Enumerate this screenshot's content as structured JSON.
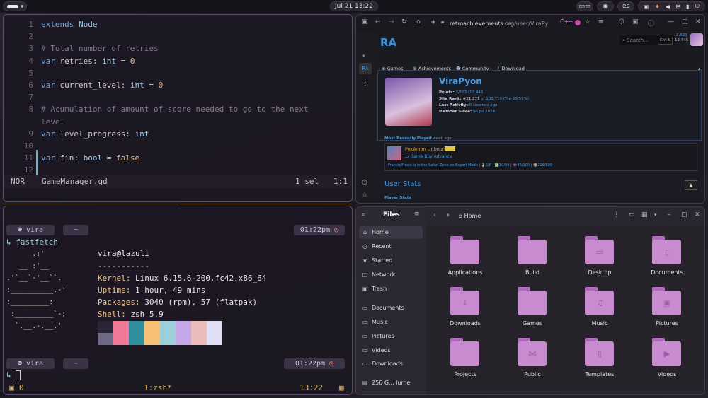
{
  "topbar": {
    "clock": "Jul 21  13:22",
    "keyboard_layout": "es",
    "tray_icons": [
      "gamepad-icon",
      "discord-icon",
      "volume-icon",
      "network-icon",
      "battery-icon",
      "power-icon"
    ]
  },
  "editor": {
    "lines": [
      {
        "num": "1",
        "parts": [
          {
            "t": "extends ",
            "c": "kw"
          },
          {
            "t": "Node",
            "c": "ty"
          }
        ]
      },
      {
        "num": "2",
        "parts": []
      },
      {
        "num": "3",
        "parts": [
          {
            "t": "# Total number of retries",
            "c": "comment"
          }
        ]
      },
      {
        "num": "4",
        "parts": [
          {
            "t": "var ",
            "c": "kw"
          },
          {
            "t": "retries: ",
            "c": ""
          },
          {
            "t": "int",
            "c": "ty"
          },
          {
            "t": " = ",
            "c": ""
          },
          {
            "t": "0",
            "c": "val"
          }
        ]
      },
      {
        "num": "5",
        "parts": []
      },
      {
        "num": "6",
        "parts": [
          {
            "t": "var ",
            "c": "kw"
          },
          {
            "t": "current_level: ",
            "c": ""
          },
          {
            "t": "int",
            "c": "ty"
          },
          {
            "t": " = ",
            "c": ""
          },
          {
            "t": "0",
            "c": "val"
          }
        ]
      },
      {
        "num": "7",
        "parts": []
      },
      {
        "num": "8",
        "parts": [
          {
            "t": "# Acumulation of amount of score needed to go to the next",
            "c": "comment"
          }
        ]
      },
      {
        "num": "",
        "parts": [
          {
            "t": "level",
            "c": "comment"
          }
        ]
      },
      {
        "num": "9",
        "parts": [
          {
            "t": "var ",
            "c": "kw"
          },
          {
            "t": "level_progress: ",
            "c": ""
          },
          {
            "t": "int",
            "c": "ty"
          }
        ]
      },
      {
        "num": "10",
        "parts": []
      },
      {
        "num": "11",
        "parts": [
          {
            "t": "var ",
            "c": "kw"
          },
          {
            "t": "fin: ",
            "c": ""
          },
          {
            "t": "bool",
            "c": "ty"
          },
          {
            "t": " = ",
            "c": ""
          },
          {
            "t": "false",
            "c": "val"
          }
        ]
      },
      {
        "num": "12",
        "parts": []
      }
    ],
    "status": {
      "mode": "NOR",
      "file": "GameManager.gd",
      "selection": "1 sel",
      "position": "1:1"
    }
  },
  "terminal": {
    "prompt_user": "vira",
    "prompt_dir": "~",
    "prompt_time": "01:22pm",
    "command": "fastfetch",
    "ascii": [
      "      .:'",
      "   __ :'__",
      ".'`__`-'__``.",
      ":__________.-'",
      ":_________:",
      " :_________`-;",
      "  `.__.-.__.'"
    ],
    "userhost": "vira@lazuli",
    "separator": "-----------",
    "info": [
      {
        "key": "Kernel",
        "value": "Linux 6.15.6-200.fc42.x86_64"
      },
      {
        "key": "Uptime",
        "value": "1 hour, 49 mins"
      },
      {
        "key": "Packages",
        "value": "3040 (rpm), 57 (flatpak)"
      },
      {
        "key": "Shell",
        "value": "zsh 5.9"
      }
    ],
    "palette_top": [
      "#2b2436",
      "#f07896",
      "#2f8f9d",
      "#f6c177",
      "#9ccfd8",
      "#c4a7e7",
      "#ebbcba",
      "#e0def4"
    ],
    "palette_bottom": [
      "#6e6a86",
      "#f07896",
      "#2f8f9d",
      "#f6c177",
      "#9ccfd8",
      "#c4a7e7",
      "#ebbcba",
      "#e0def4"
    ],
    "tmux": {
      "session": "0",
      "window": "1:zsh*",
      "time": "13:22"
    }
  },
  "browser": {
    "url_host": "retroachievements.org",
    "url_path": "/user/ViraPy",
    "nav": [
      "Games",
      "Achievements",
      "Community",
      "Download"
    ],
    "search_placeholder": "Search...",
    "search_shortcut": "Ctrl K",
    "points_header": "3,523",
    "points_header_2": "12,445",
    "profile": {
      "name": "ViraPyon",
      "points_label": "Points:",
      "points": "3,523 (12,445)",
      "rank_label": "Site Rank:",
      "rank": "#21,271",
      "rank_detail": "of 103,719 (Top 20.51%)",
      "activity_label": "Last Activity:",
      "activity": "0 seconds ago",
      "member_label": "Member Since:",
      "member": "06 Jul 2024"
    },
    "recent_label": "Most Recently Played",
    "recent_time": "1 week ago",
    "game_title": "Pokémon Unbound",
    "game_console": "Game Boy Advance",
    "rich_presence": "Francis/Fresia is in the Safari Zone on Expert Mode | 🏅6/8 | ✅19/84 | 👾46/100 | 🔘229/809",
    "user_stats": "User Stats",
    "player_stats": "Player Stats"
  },
  "files": {
    "title": "Files",
    "location": "Home",
    "sidebar": [
      {
        "label": "Home",
        "icon": "home-icon",
        "glyph": "⌂"
      },
      {
        "label": "Recent",
        "icon": "clock-icon",
        "glyph": "◷"
      },
      {
        "label": "Starred",
        "icon": "star-icon",
        "glyph": "★"
      },
      {
        "label": "Network",
        "icon": "network-icon",
        "glyph": "◫"
      },
      {
        "label": "Trash",
        "icon": "trash-icon",
        "glyph": "▣"
      },
      {
        "label": "Documents",
        "icon": "folder-icon",
        "glyph": "▭"
      },
      {
        "label": "Music",
        "icon": "folder-icon",
        "glyph": "▭"
      },
      {
        "label": "Pictures",
        "icon": "folder-icon",
        "glyph": "▭"
      },
      {
        "label": "Videos",
        "icon": "folder-icon",
        "glyph": "▭"
      },
      {
        "label": "Downloads",
        "icon": "folder-icon",
        "glyph": "▭"
      },
      {
        "label": "256 G... lume",
        "icon": "drive-icon",
        "glyph": "▤"
      }
    ],
    "folders": [
      {
        "label": "Applications",
        "glyph": ""
      },
      {
        "label": "Build",
        "glyph": ""
      },
      {
        "label": "Desktop",
        "glyph": "▭"
      },
      {
        "label": "Documents",
        "glyph": "▯"
      },
      {
        "label": "Downloads",
        "glyph": "↓"
      },
      {
        "label": "Games",
        "glyph": ""
      },
      {
        "label": "Music",
        "glyph": "♫"
      },
      {
        "label": "Pictures",
        "glyph": "▣"
      },
      {
        "label": "Projects",
        "glyph": ""
      },
      {
        "label": "Public",
        "glyph": "⋈"
      },
      {
        "label": "Templates",
        "glyph": "▯"
      },
      {
        "label": "Videos",
        "glyph": "▶"
      }
    ]
  }
}
